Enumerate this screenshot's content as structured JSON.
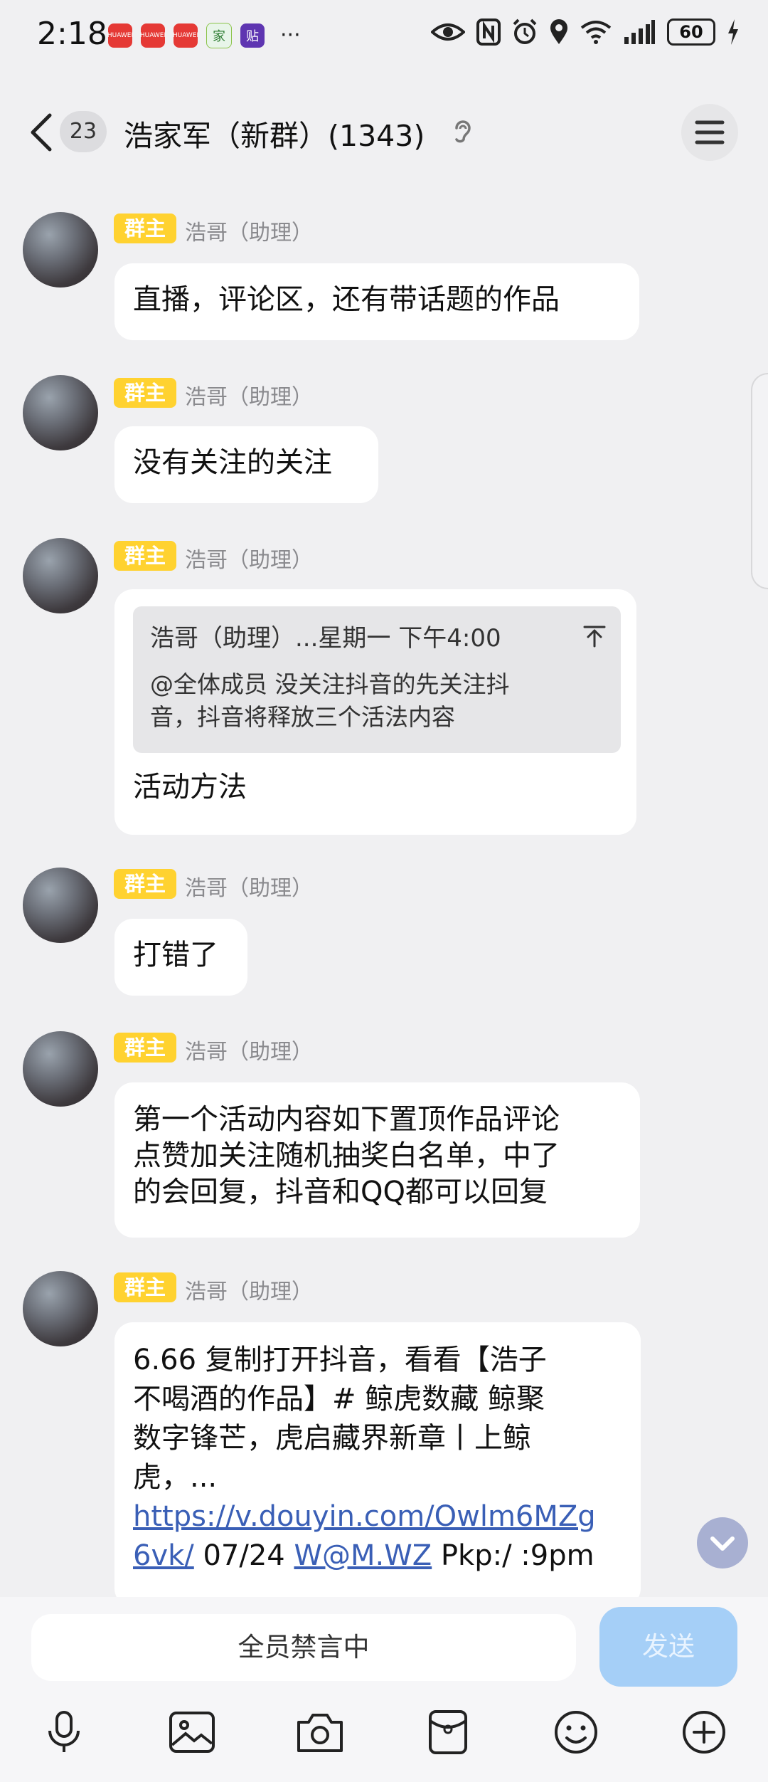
{
  "status_bar": {
    "time": "2:18",
    "notification_apps": [
      "HUAWEI",
      "HUAWEI",
      "HUAWEI",
      "家",
      "贴"
    ],
    "more": "···",
    "battery": "60"
  },
  "header": {
    "unread_count": "23",
    "title": "浩家军（新群）(1343)"
  },
  "messages": [
    {
      "badge": "群主",
      "sender": "浩哥（助理）",
      "text": "直播，评论区，还有带话题的作品"
    },
    {
      "badge": "群主",
      "sender": "浩哥（助理）",
      "text": "没有关注的关注"
    },
    {
      "badge": "群主",
      "sender": "浩哥（助理）",
      "quote": {
        "header": "浩哥（助理）...星期一 下午4:00",
        "line1": "@全体成员 没关注抖音的先关注抖",
        "line2": "音，抖音将释放三个活法内容"
      },
      "text": "活动方法"
    },
    {
      "badge": "群主",
      "sender": "浩哥（助理）",
      "text": "打错了"
    },
    {
      "badge": "群主",
      "sender": "浩哥（助理）",
      "lines": [
        "第一个活动内容如下置顶作品评论",
        "点赞加关注随机抽奖白名单，中了",
        "的会回复，抖音和QQ都可以回复"
      ]
    },
    {
      "badge": "群主",
      "sender": "浩哥（助理）",
      "lines": [
        "6.66 复制打开抖音，看看【浩子",
        "不喝酒的作品】# 鲸虎数藏 鲸聚",
        "数字锋芒，虎启藏界新章丨上鲸",
        "虎，..."
      ],
      "link1": "https://v.douyin.com/Owlm6MZg",
      "link2": "6vk/",
      "date": " 07/24 ",
      "link3": "W@M.WZ",
      "tail": " Pkp:/ :9pm"
    }
  ],
  "input": {
    "mute_text": "全员禁言中",
    "send_label": "发送"
  },
  "toolbar": [
    "voice-icon",
    "image-icon",
    "camera-icon",
    "sticker-box-icon",
    "emoji-icon",
    "plus-icon"
  ],
  "colors": {
    "background": "#f0f0f2",
    "owner_badge": "#ffd230",
    "link": "#3a5fb6",
    "send_disabled": "#a5cff7"
  }
}
